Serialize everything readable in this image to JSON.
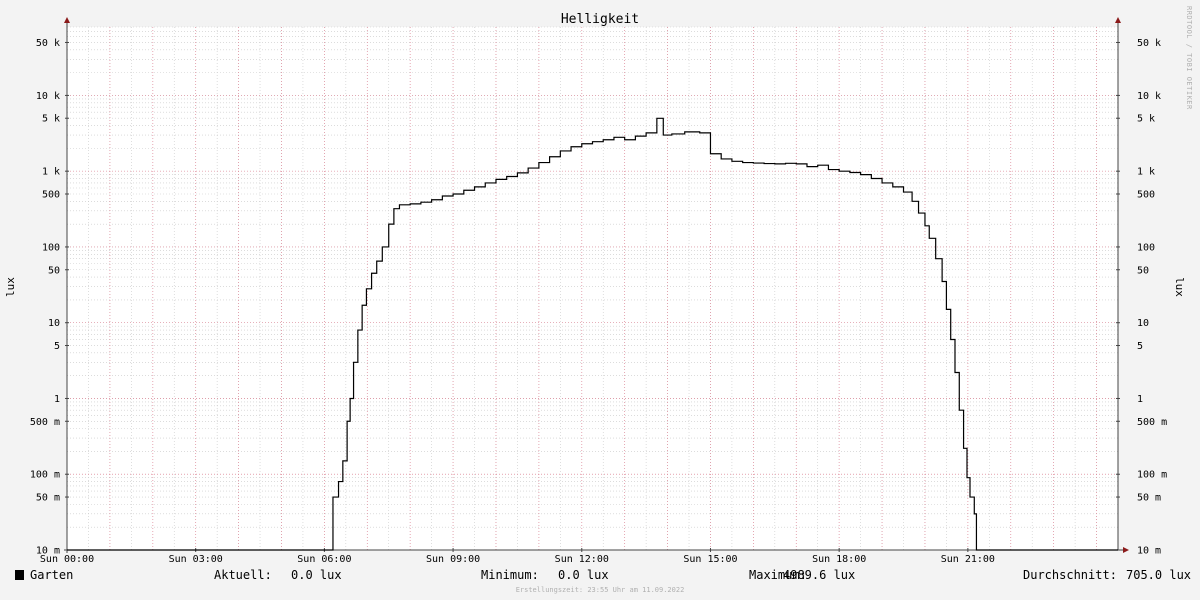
{
  "chart_data": {
    "type": "line",
    "title": "Helligkeit",
    "ylabel": "lux",
    "yscale": "log",
    "ylim": [
      0.01,
      80000
    ],
    "xlim": [
      0,
      24.5
    ],
    "grid": true,
    "y_ticks": [
      {
        "value": 50000,
        "label": "50 k"
      },
      {
        "value": 10000,
        "label": "10 k"
      },
      {
        "value": 5000,
        "label": "5 k"
      },
      {
        "value": 1000,
        "label": "1 k"
      },
      {
        "value": 500,
        "label": "500"
      },
      {
        "value": 100,
        "label": "100"
      },
      {
        "value": 50,
        "label": "50"
      },
      {
        "value": 10,
        "label": "10"
      },
      {
        "value": 5,
        "label": "5"
      },
      {
        "value": 1,
        "label": "1"
      },
      {
        "value": 0.5,
        "label": "500 m"
      },
      {
        "value": 0.1,
        "label": "100 m"
      },
      {
        "value": 0.05,
        "label": "50 m"
      },
      {
        "value": 0.01,
        "label": "10 m"
      }
    ],
    "x_ticks": [
      {
        "value": 0,
        "label": "Sun 00:00"
      },
      {
        "value": 3,
        "label": "Sun 03:00"
      },
      {
        "value": 6,
        "label": "Sun 06:00"
      },
      {
        "value": 9,
        "label": "Sun 09:00"
      },
      {
        "value": 12,
        "label": "Sun 12:00"
      },
      {
        "value": 15,
        "label": "Sun 15:00"
      },
      {
        "value": 18,
        "label": "Sun 18:00"
      },
      {
        "value": 21,
        "label": "Sun 21:00"
      }
    ],
    "series": [
      {
        "name": "Garten",
        "color": "#000000",
        "points": [
          [
            0,
            0.01
          ],
          [
            6.15,
            0.01
          ],
          [
            6.2,
            0.05
          ],
          [
            6.33,
            0.08
          ],
          [
            6.43,
            0.15
          ],
          [
            6.53,
            0.5
          ],
          [
            6.6,
            1.0
          ],
          [
            6.68,
            3
          ],
          [
            6.78,
            8
          ],
          [
            6.88,
            17
          ],
          [
            6.98,
            28
          ],
          [
            7.1,
            45
          ],
          [
            7.22,
            65
          ],
          [
            7.35,
            100
          ],
          [
            7.5,
            200
          ],
          [
            7.62,
            320
          ],
          [
            7.75,
            360
          ],
          [
            8.0,
            370
          ],
          [
            8.25,
            390
          ],
          [
            8.5,
            420
          ],
          [
            8.75,
            470
          ],
          [
            9.0,
            500
          ],
          [
            9.25,
            560
          ],
          [
            9.5,
            620
          ],
          [
            9.75,
            700
          ],
          [
            10.0,
            780
          ],
          [
            10.25,
            850
          ],
          [
            10.5,
            950
          ],
          [
            10.75,
            1100
          ],
          [
            11.0,
            1300
          ],
          [
            11.25,
            1550
          ],
          [
            11.5,
            1850
          ],
          [
            11.75,
            2100
          ],
          [
            12.0,
            2300
          ],
          [
            12.25,
            2450
          ],
          [
            12.5,
            2600
          ],
          [
            12.75,
            2800
          ],
          [
            13.0,
            2600
          ],
          [
            13.25,
            2900
          ],
          [
            13.5,
            3200
          ],
          [
            13.75,
            4989.6
          ],
          [
            13.9,
            3000
          ],
          [
            14.1,
            3100
          ],
          [
            14.4,
            3300
          ],
          [
            14.75,
            3200
          ],
          [
            15.0,
            1700
          ],
          [
            15.25,
            1450
          ],
          [
            15.5,
            1350
          ],
          [
            15.75,
            1300
          ],
          [
            16.0,
            1280
          ],
          [
            16.25,
            1260
          ],
          [
            16.5,
            1250
          ],
          [
            16.75,
            1270
          ],
          [
            17.0,
            1250
          ],
          [
            17.25,
            1150
          ],
          [
            17.5,
            1200
          ],
          [
            17.75,
            1050
          ],
          [
            18.0,
            1000
          ],
          [
            18.25,
            960
          ],
          [
            18.5,
            900
          ],
          [
            18.75,
            800
          ],
          [
            19.0,
            700
          ],
          [
            19.25,
            620
          ],
          [
            19.5,
            530
          ],
          [
            19.7,
            400
          ],
          [
            19.85,
            280
          ],
          [
            20.0,
            190
          ],
          [
            20.1,
            130
          ],
          [
            20.25,
            70
          ],
          [
            20.4,
            35
          ],
          [
            20.5,
            15
          ],
          [
            20.6,
            6
          ],
          [
            20.7,
            2.2
          ],
          [
            20.8,
            0.7
          ],
          [
            20.9,
            0.22
          ],
          [
            20.98,
            0.09
          ],
          [
            21.05,
            0.05
          ],
          [
            21.15,
            0.03
          ],
          [
            21.2,
            0.01
          ],
          [
            24.5,
            0.01
          ]
        ]
      }
    ],
    "legend": [
      {
        "label": "Garten",
        "color": "#000000"
      }
    ],
    "stats": {
      "current_label": "Aktuell:",
      "current_value": "0.0 lux",
      "min_label": "Minimum:",
      "min_value": "0.0 lux",
      "max_label": "Maximum:",
      "max_value": "4989.6 lux",
      "avg_label": "Durchschnitt:",
      "avg_value": "705.0 lux"
    },
    "footer": "Erstellungszeit: 23:55 Uhr am 11.09.2022",
    "watermark": "RRDTOOL / TOBI OETIKER",
    "colors": {
      "background": "#f3f3f3",
      "plot_background": "#ffffff",
      "major_grid": "#e08a9a",
      "minor_grid": "#c8c8c8",
      "axis": "#444444",
      "arrow": "#8b1a1a"
    }
  }
}
